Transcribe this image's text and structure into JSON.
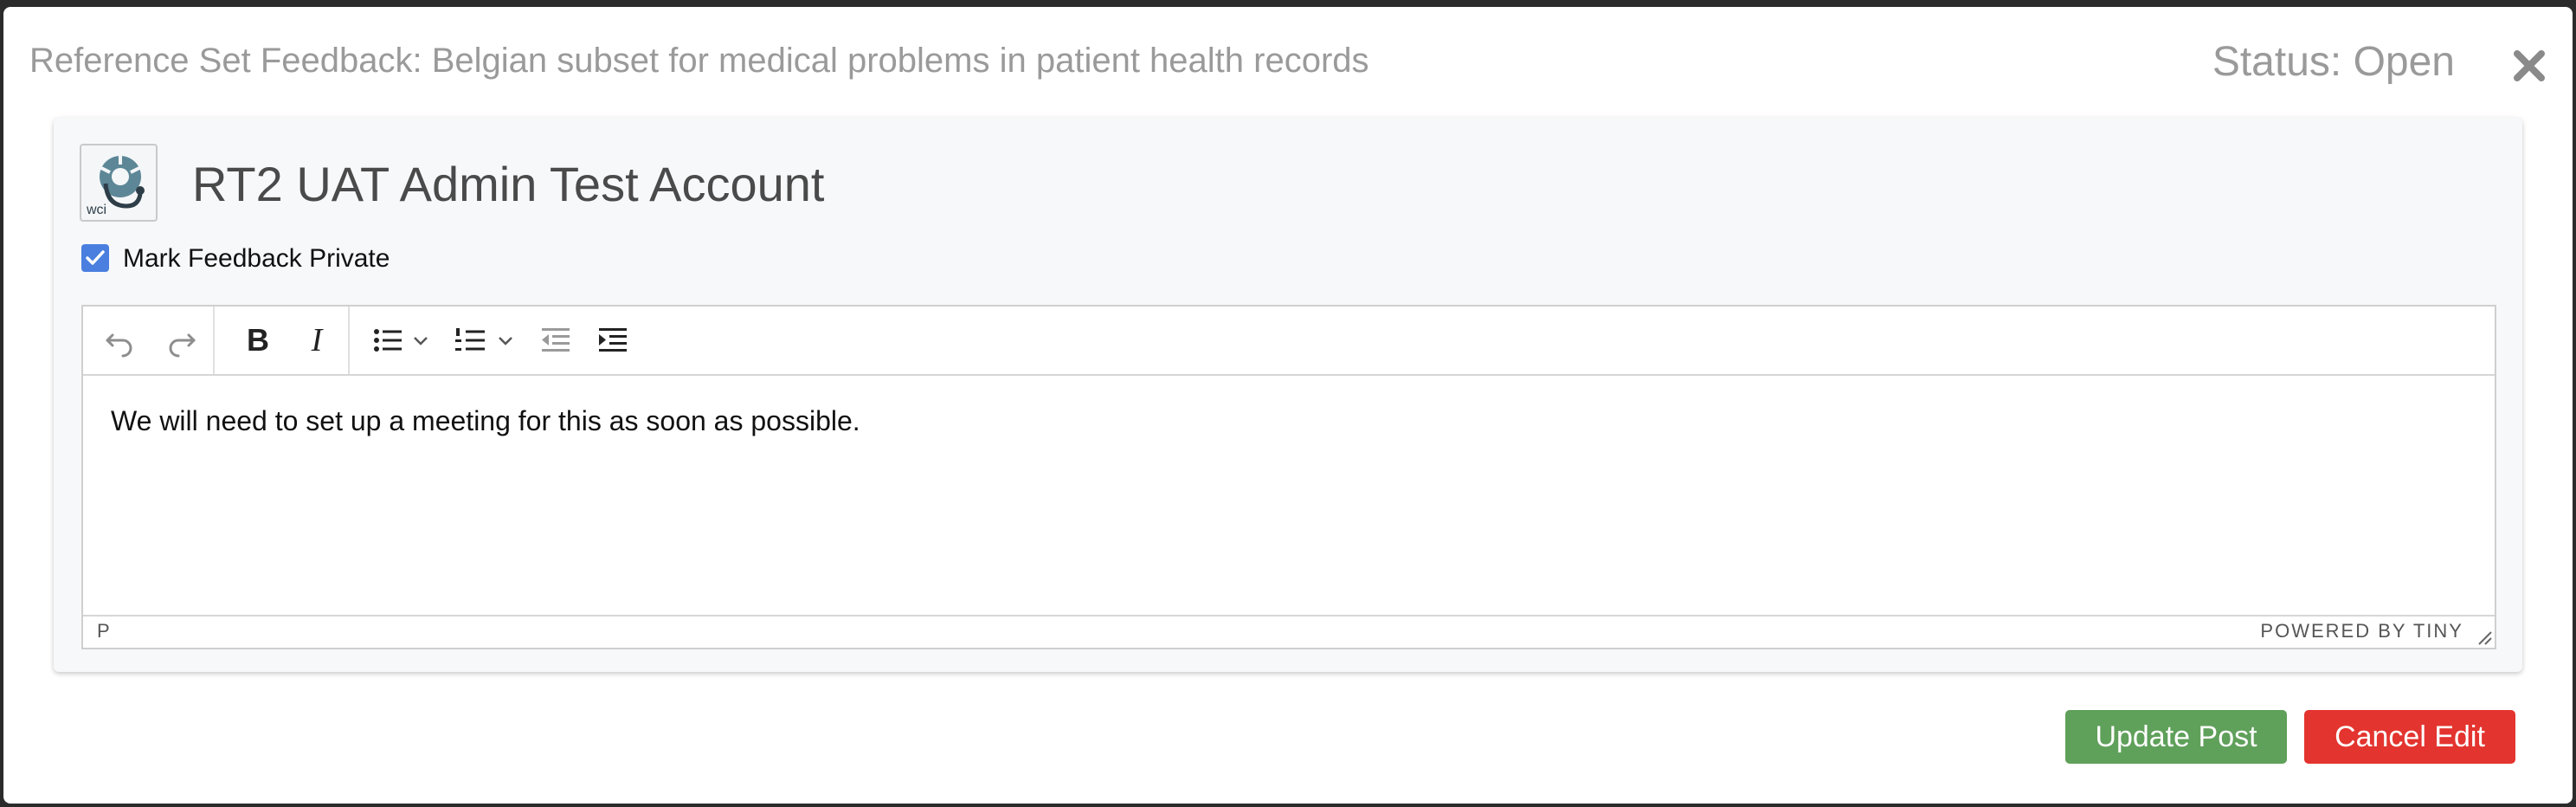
{
  "modal": {
    "title": "Reference Set Feedback: Belgian subset for medical problems in patient health records",
    "status": "Status: Open",
    "close_icon": "close-icon"
  },
  "post": {
    "avatar_text": "WCI",
    "account_name": "RT2 UAT Admin Test Account",
    "mark_private_label": "Mark Feedback Private",
    "mark_private_checked": true
  },
  "editor": {
    "toolbar": [
      "undo-icon",
      "redo-icon",
      "bold-icon",
      "italic-icon",
      "bullet-list-icon",
      "chevron-down-icon",
      "numbered-list-icon",
      "chevron-down-icon",
      "outdent-icon",
      "indent-icon"
    ],
    "content": "We will need to set up a meeting for this as soon as possible.",
    "path": "P",
    "branding": "POWERED BY TINY"
  },
  "actions": {
    "update_label": "Update Post",
    "cancel_label": "Cancel Edit"
  },
  "colors": {
    "update": "#5fa05a",
    "cancel": "#e3342f",
    "checkbox": "#4a7fe0"
  }
}
